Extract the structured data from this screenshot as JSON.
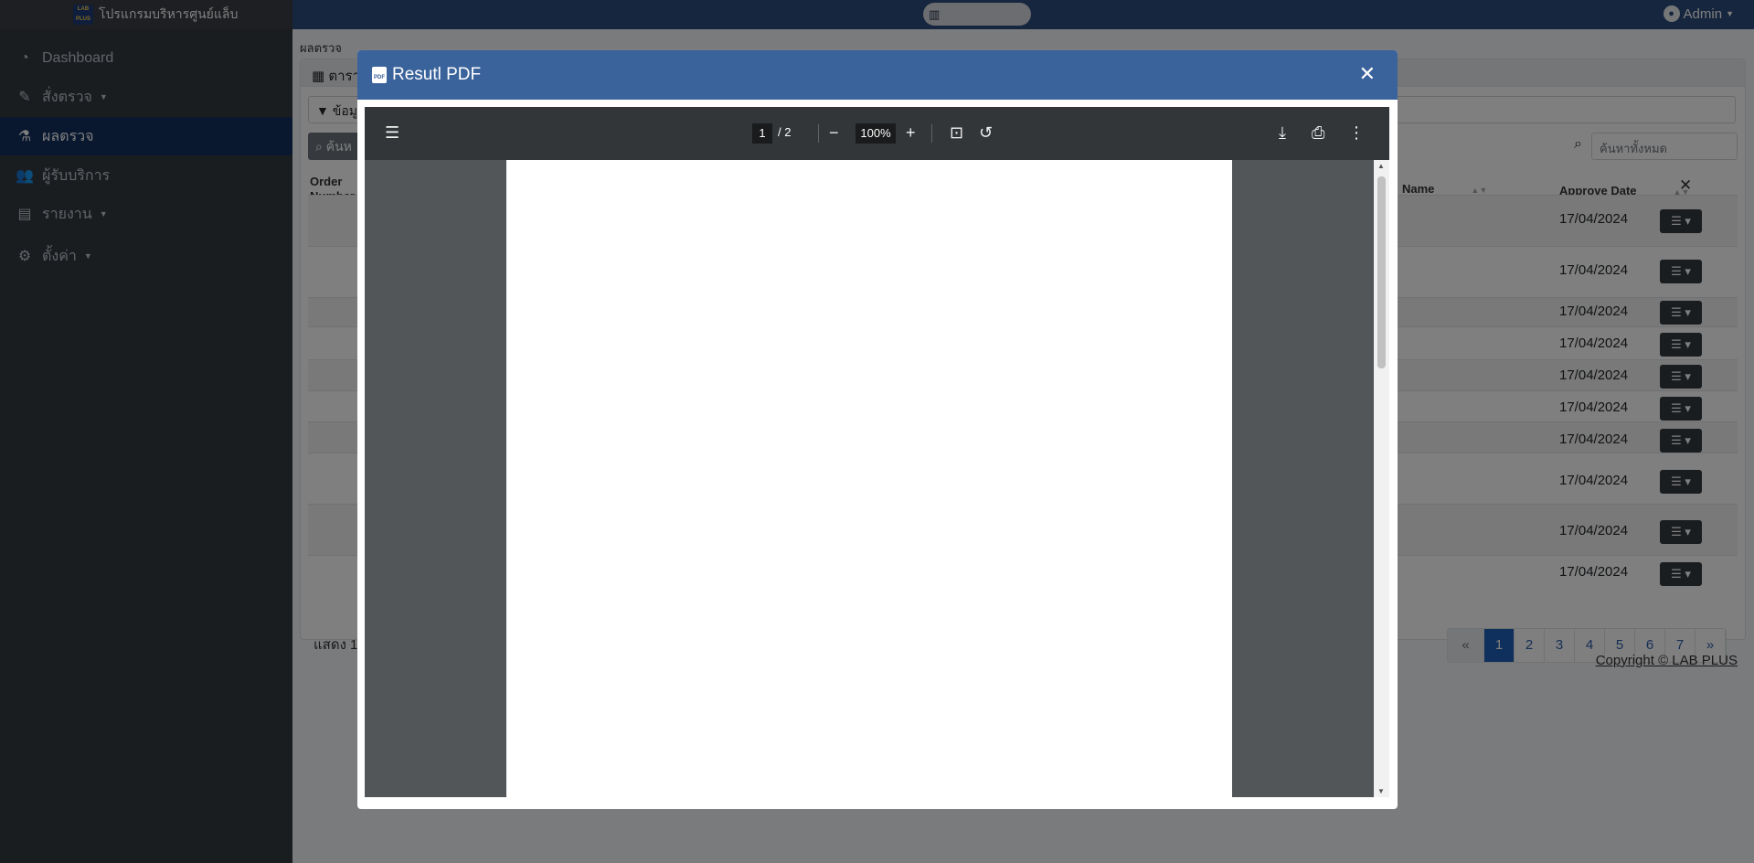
{
  "topbar": {
    "app_name": "โปรแกรมบริหารศูนย์แล็บ",
    "logo_text": "LAB PLUS",
    "user_label": "Admin"
  },
  "sidebar": {
    "items": [
      {
        "label": "Dashboard",
        "icon": "dashboard-icon"
      },
      {
        "label": "สั่งตรวจ",
        "icon": "syringe-icon"
      },
      {
        "label": "ผลตรวจ",
        "icon": "flask-icon"
      },
      {
        "label": "ผู้รับบริการ",
        "icon": "users-icon"
      },
      {
        "label": "รายงาน",
        "icon": "report-icon"
      },
      {
        "label": "ตั้งค่า",
        "icon": "gear-icon"
      }
    ]
  },
  "content": {
    "breadcrumb": "ผลตรวจ",
    "card_title": "ตาราง",
    "filter_label": "ข้อมูล",
    "search_left_label": "ค้นห",
    "search_placeholder": "ค้นหาทั้งหมด",
    "columns": {
      "order_number": "Order Number",
      "name": "Name",
      "approve_date": "Approve Date"
    },
    "rows": [
      {
        "date": "17/04/2024"
      },
      {
        "date": "17/04/2024"
      },
      {
        "date": "17/04/2024"
      },
      {
        "date": "17/04/2024"
      },
      {
        "date": "17/04/2024"
      },
      {
        "date": "17/04/2024"
      },
      {
        "date": "17/04/2024"
      },
      {
        "date": "17/04/2024"
      },
      {
        "date": "17/04/2024"
      },
      {
        "date": "17/04/2024"
      }
    ],
    "showing_text": "แสดง 1",
    "pages": [
      "1",
      "2",
      "3",
      "4",
      "5",
      "6",
      "7"
    ],
    "copyright": "Copyright © LAB PLUS"
  },
  "modal": {
    "title": "Resutl PDF",
    "viewer": {
      "current_page": "1",
      "total_pages": "/  2",
      "zoom": "100%"
    }
  }
}
